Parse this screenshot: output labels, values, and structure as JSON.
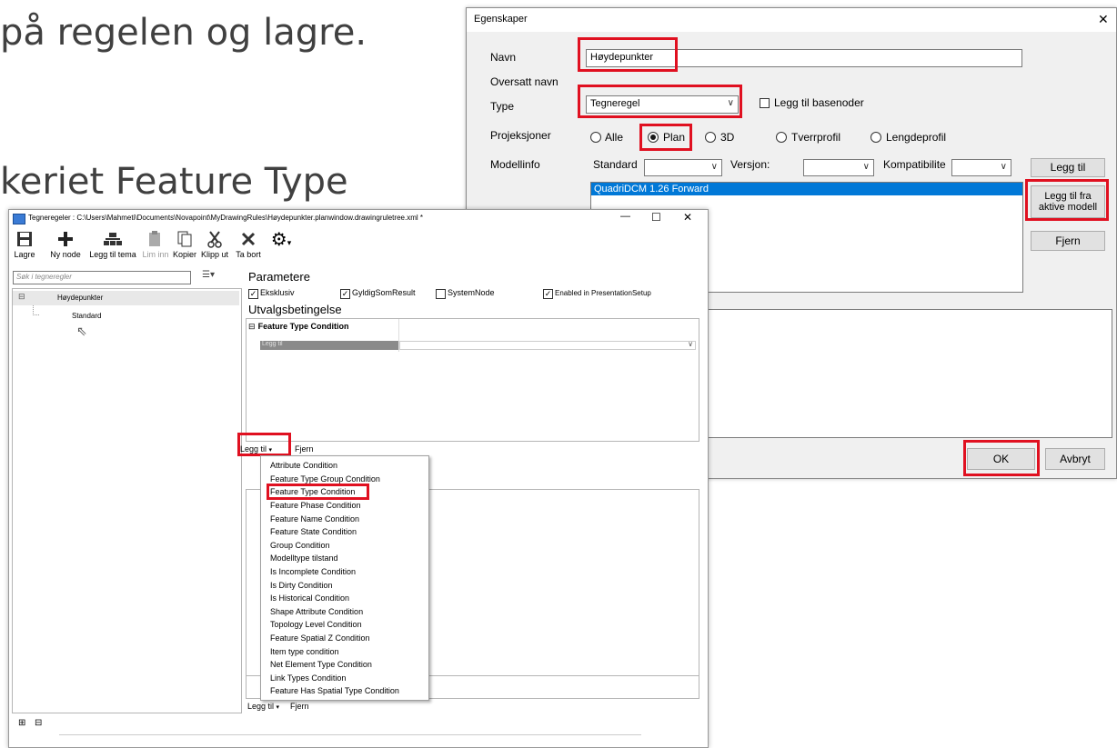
{
  "slide": {
    "line1": "på regelen og lagre.",
    "line2": "keriet Feature Type"
  },
  "dialog": {
    "title": "Egenskaper",
    "close_glyph": "✕",
    "navn_label": "Navn",
    "navn_value": "Høydepunkter",
    "oversatt_label": "Oversatt navn",
    "type_label": "Type",
    "type_value": "Tegneregel",
    "basenoder_label": "Legg til basenoder",
    "projeksjoner_label": "Projeksjoner",
    "proj_options": [
      "Alle",
      "Plan",
      "3D",
      "Tverrprofil",
      "Lengdeprofil"
    ],
    "proj_selected": "Plan",
    "modellinfo_label": "Modellinfo",
    "standard_label": "Standard",
    "versjon_label": "Versjon:",
    "kompatibilitet_label": "Kompatibilite",
    "legg_til_button": "Legg til",
    "model_item": "QuadriDCM 1.26 Forward",
    "legg_til_fra_button_line1": "Legg til fra",
    "legg_til_fra_button_line2": "aktive modell",
    "fjern_button": "Fjern",
    "ok_button": "OK",
    "avbryt_button": "Avbryt"
  },
  "window": {
    "title": "Tegneregeler : C:\\Users\\Mahmeti\\Documents\\Novapoint\\MyDrawingRules\\Høydepunkter.planwindow.drawingruletree.xml *",
    "controls": {
      "minimize": "—",
      "maximize": "☐",
      "close": "✕"
    },
    "toolbar": {
      "lagre": "Lagre",
      "ny_node": "Ny node",
      "legg_til_tema": "Legg til tema",
      "lim_inn": "Lim inn",
      "kopier": "Kopier",
      "klipp_ut": "Klipp ut",
      "ta_bort": "Ta bort"
    },
    "search_placeholder": "Søk i tegneregler",
    "tree_root": "Høydepunkter",
    "tree_child": "Standard",
    "parametere_heading": "Parametere",
    "checkboxes": {
      "eksklusiv": "Eksklusiv",
      "gyldig": "GyldigSomResult",
      "systemnode": "SystemNode",
      "enabled": "Enabled in PresentationSetup"
    },
    "utvalg_heading": "Utvalgsbetingelse",
    "condition_header": "Feature Type Condition",
    "condition_row": "Legg til",
    "legg_til_dropdown": "Legg til",
    "fjern_link": "Fjern",
    "bottom_legg_til": "Legg til",
    "bottom_fjern": "Fjern",
    "menu_items": [
      "Attribute Condition",
      "Feature Type Group Condition",
      "Feature Type Condition",
      "Feature Phase Condition",
      "Feature Name Condition",
      "Feature State Condition",
      "Group Condition",
      "Modelltype tilstand",
      "Is Incomplete Condition",
      "Is Dirty Condition",
      "Is Historical Condition",
      "Shape Attribute Condition",
      "Topology Level Condition",
      "Feature Spatial Z Condition",
      "Item type condition",
      "Net Element Type Condition",
      "Link Types Condition",
      "Feature Has Spatial Type Condition"
    ],
    "menu_highlighted": "Feature Type Condition"
  },
  "colors": {
    "highlight_red": "#e01020",
    "selection_blue": "#0078d7",
    "slide_text": "#404040"
  }
}
